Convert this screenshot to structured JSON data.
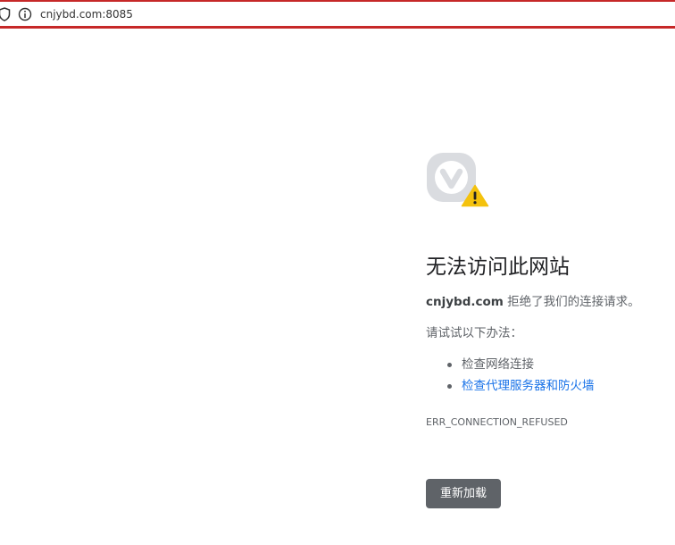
{
  "browser": {
    "url": "cnjybd.com:8085",
    "icons": {
      "left": "shield-icon",
      "site_info": "info-icon"
    },
    "accent_color": "#c62828"
  },
  "error": {
    "brand_icon": "vivaldi-logo-icon",
    "status_icon": "warning-icon",
    "title": "无法访问此网站",
    "host": "cnjybd.com",
    "refused_message": "拒绝了我们的连接请求。",
    "suggestion_heading": "请试试以下办法：",
    "suggestions": [
      {
        "label": "检查网络连接",
        "is_link": false
      },
      {
        "label": "检查代理服务器和防火墙",
        "is_link": true
      }
    ],
    "code": "ERR_CONNECTION_REFUSED",
    "reload_label": "重新加载",
    "colors": {
      "text": "#5f6368",
      "link": "#1a73e8",
      "button": "#5f6368",
      "warning": "#f4c20d"
    }
  }
}
